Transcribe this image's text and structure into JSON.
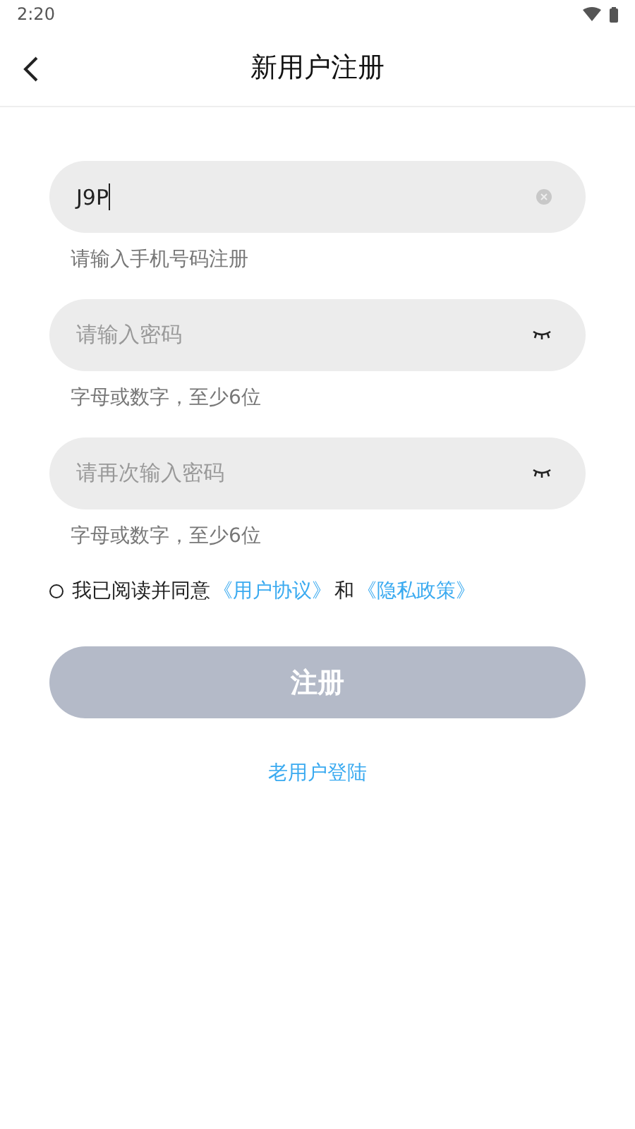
{
  "status_bar": {
    "time": "2:20"
  },
  "header": {
    "title": "新用户注册"
  },
  "fields": [
    {
      "kind": "clear",
      "value": "J9P",
      "hint": "请输入手机号码注册"
    },
    {
      "kind": "eye",
      "placeholder": "请输入密码",
      "hint": "字母或数字，至少6位"
    },
    {
      "kind": "eye",
      "placeholder": "请再次输入密码",
      "hint": "字母或数字，至少6位"
    }
  ],
  "agreement": {
    "checked": false,
    "parts": [
      {
        "kind": "text",
        "text": "我已阅读并同意"
      },
      {
        "kind": "link",
        "text": "《用户协议》"
      },
      {
        "kind": "text",
        "text": "和"
      },
      {
        "kind": "link",
        "text": "《隐私政策》"
      }
    ]
  },
  "register_button": {
    "label": "注册",
    "disabled": true
  },
  "login_link": "老用户登陆"
}
